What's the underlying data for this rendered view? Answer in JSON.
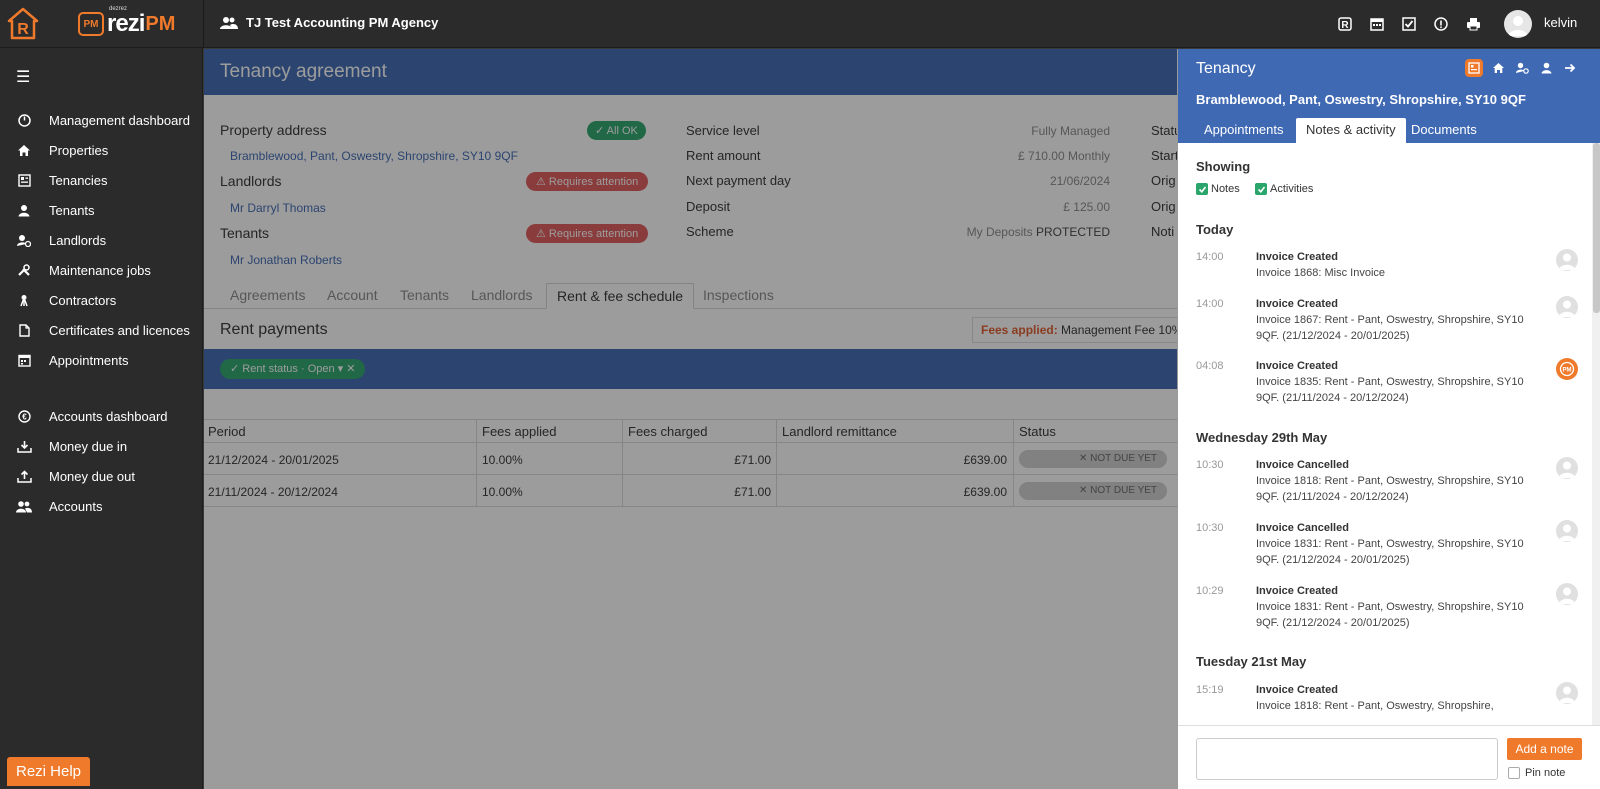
{
  "topbar": {
    "brand_small": "dezrez",
    "brand_word": "rezi",
    "brand_pm": "PM",
    "brand_badge": "PM",
    "agency": "TJ Test Accounting PM Agency",
    "user_name": "kelvin",
    "icons": [
      "rezi-r-icon",
      "calendar-icon",
      "checkbox-icon",
      "alert-icon",
      "print-icon"
    ]
  },
  "sidebar": {
    "items": [
      {
        "label": "Management dashboard",
        "icon": "dashboard-icon"
      },
      {
        "label": "Properties",
        "icon": "home-icon"
      },
      {
        "label": "Tenancies",
        "icon": "tenancy-icon"
      },
      {
        "label": "Tenants",
        "icon": "person-icon"
      },
      {
        "label": "Landlords",
        "icon": "landlord-icon"
      },
      {
        "label": "Maintenance jobs",
        "icon": "tools-icon"
      },
      {
        "label": "Contractors",
        "icon": "contractor-icon"
      },
      {
        "label": "Certificates and licences",
        "icon": "document-icon"
      },
      {
        "label": "Appointments",
        "icon": "calendar-icon"
      },
      {
        "label": "Accounts dashboard",
        "icon": "currency-icon"
      },
      {
        "label": "Money due in",
        "icon": "money-in-icon"
      },
      {
        "label": "Money due out",
        "icon": "money-out-icon"
      },
      {
        "label": "Accounts",
        "icon": "group-icon"
      }
    ],
    "help_label": "Rezi Help"
  },
  "main": {
    "title": "Tenancy agreement",
    "property_label": "Property address",
    "property_status": "All OK",
    "property_address": "Bramblewood, Pant, Oswestry, Shropshire, SY10 9QF",
    "landlords_label": "Landlords",
    "landlords_status": "Requires attention",
    "landlord_name": "Mr Darryl Thomas",
    "tenants_label": "Tenants",
    "tenants_status": "Requires attention",
    "tenant_name": "Mr Jonathan Roberts",
    "details": [
      {
        "label": "Service level",
        "value": "Fully Managed"
      },
      {
        "label": "Rent amount",
        "value": "£ 710.00 Monthly"
      },
      {
        "label": "Next payment day",
        "value": "21/06/2024"
      },
      {
        "label": "Deposit",
        "value": "£ 125.00"
      },
      {
        "label": "Scheme",
        "value_prefix": "My Deposits",
        "value_strong": "PROTECTED"
      }
    ],
    "right_col_partial": [
      "Statu",
      "Start",
      "Orig",
      "Orig",
      "Noti"
    ],
    "tabs": [
      "Agreements",
      "Account",
      "Tenants",
      "Landlords",
      "Rent & fee schedule",
      "Inspections"
    ],
    "rent_title": "Rent payments",
    "fees_applied_label": "Fees applied:",
    "fees_applied_value": "Management Fee 10%",
    "filter_chip": "Rent status · Open",
    "table": {
      "headers": [
        "Period",
        "Fees applied",
        "Fees charged",
        "Landlord remittance",
        "Status"
      ],
      "rows": [
        {
          "period": "21/12/2024 - 20/01/2025",
          "fees_applied": "10.00%",
          "fees_charged": "£71.00",
          "remittance": "£639.00",
          "status": "NOT DUE YET"
        },
        {
          "period": "21/11/2024 - 20/12/2024",
          "fees_applied": "10.00%",
          "fees_charged": "£71.00",
          "remittance": "£639.00",
          "status": "NOT DUE YET"
        }
      ]
    }
  },
  "panel": {
    "title": "Tenancy",
    "subtitle": "Bramblewood, Pant, Oswestry, Shropshire, SY10 9QF",
    "icons": [
      "tenancy-icon",
      "home-icon",
      "landlord-icon",
      "person-icon",
      "arrow-right-icon"
    ],
    "tabs": [
      "Appointments",
      "Notes & activity",
      "Documents"
    ],
    "active_tab": "Notes & activity",
    "showing_label": "Showing",
    "filters": [
      {
        "label": "Notes",
        "checked": true
      },
      {
        "label": "Activities",
        "checked": true
      }
    ],
    "groups": [
      {
        "day": "Today",
        "items": [
          {
            "time": "14:00",
            "title": "Invoice Created",
            "desc": "Invoice 1868: Misc Invoice",
            "avatar": "user"
          },
          {
            "time": "14:00",
            "title": "Invoice Created",
            "desc": "Invoice 1867: Rent - Pant, Oswestry, Shropshire, SY10 9QF. (21/12/2024 - 20/01/2025)",
            "avatar": "user"
          },
          {
            "time": "04:08",
            "title": "Invoice Created",
            "desc": "Invoice 1835: Rent - Pant, Oswestry, Shropshire, SY10 9QF. (21/11/2024 - 20/12/2024)",
            "avatar": "pm"
          }
        ]
      },
      {
        "day": "Wednesday 29th May",
        "items": [
          {
            "time": "10:30",
            "title": "Invoice Cancelled",
            "desc": "Invoice 1818: Rent - Pant, Oswestry, Shropshire, SY10 9QF. (21/11/2024 - 20/12/2024)",
            "avatar": "user"
          },
          {
            "time": "10:30",
            "title": "Invoice Cancelled",
            "desc": "Invoice 1831: Rent - Pant, Oswestry, Shropshire, SY10 9QF. (21/12/2024 - 20/01/2025)",
            "avatar": "user"
          },
          {
            "time": "10:29",
            "title": "Invoice Created",
            "desc": "Invoice 1831: Rent - Pant, Oswestry, Shropshire, SY10 9QF. (21/12/2024 - 20/01/2025)",
            "avatar": "user"
          }
        ]
      },
      {
        "day": "Tuesday 21st May",
        "items": [
          {
            "time": "15:19",
            "title": "Invoice Created",
            "desc": "Invoice 1818: Rent - Pant, Oswestry, Shropshire,",
            "avatar": "user"
          }
        ]
      }
    ],
    "note_placeholder": "",
    "add_note_label": "Add a note",
    "pin_note_label": "Pin note"
  }
}
